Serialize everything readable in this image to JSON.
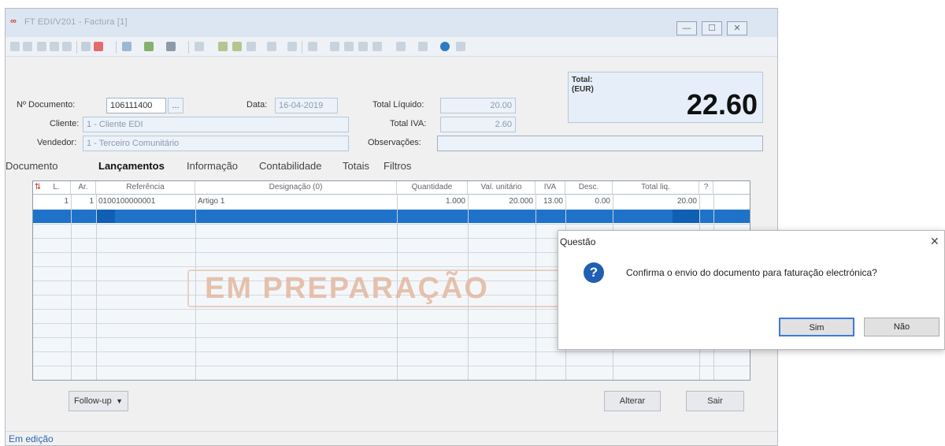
{
  "window": {
    "logo": "∞",
    "title": "FT EDI/V201 - Factura [1]",
    "minimize": "—",
    "maximize": "☐",
    "close": "✕"
  },
  "form": {
    "num_doc_label": "Nº Documento:",
    "num_doc_value": "106111400",
    "ellipsis": "...",
    "date_label": "Data:",
    "date_value": "16-04-2019",
    "total_liquido_label": "Total Líquido:",
    "total_liquido_value": "20.00",
    "total_label": "Total:\n(EUR)",
    "total_value": "22.60",
    "cliente_label": "Cliente:",
    "cliente_value": "1 - Cliente EDI",
    "total_iva_label": "Total IVA:",
    "total_iva_value": "2.60",
    "vendedor_label": "Vendedor:",
    "vendedor_value": "1 - Terceiro Comunitário",
    "observacoes_label": "Observações:",
    "observacoes_value": ""
  },
  "tabs": [
    "Documento",
    "Lançamentos",
    "Informação",
    "Contabilidade",
    "Totais",
    "Filtros"
  ],
  "grid": {
    "headers": [
      "L.",
      "Ar.",
      "Referência",
      "Designação (0)",
      "Quantidade",
      "Val. unitário",
      "IVA",
      "Desc.",
      "Total liq.",
      "?"
    ],
    "rows": [
      [
        "1",
        "1",
        "0100100000001",
        "Artigo 1",
        "1.000",
        "20.000",
        "13.00",
        "0.00",
        "20.00",
        ""
      ]
    ]
  },
  "watermark": "EM PREPARAÇÃO",
  "buttons": {
    "followup": "Follow-up",
    "followup_arrow": "▼",
    "alterar": "Alterar",
    "sair": "Sair"
  },
  "status": "Em edição",
  "dialog": {
    "title": "Questão",
    "close": "✕",
    "icon": "?",
    "message": "Confirma o envio do documento para faturação electrónica?",
    "yes": "Sim",
    "no": "Não"
  },
  "colors": {
    "selection": "#1e73c8",
    "dialog_icon": "#1f5fb4",
    "watermark": "#e3b8a0"
  }
}
